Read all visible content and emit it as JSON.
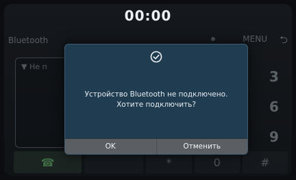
{
  "status": {
    "clock": "00:00"
  },
  "background_ui": {
    "title": "Bluetooth",
    "menu_label": "MENU",
    "back_icon": "back-arrow-icon",
    "input_text": "Не п",
    "keypad_digits": [
      "3",
      "6",
      "9"
    ],
    "bottom_keys": [
      "*",
      "0",
      "#"
    ]
  },
  "dialog": {
    "icon": "check-circle-icon",
    "message_line1": "Устройство Bluetooth не подключено.",
    "message_line2": "Хотите подключить?",
    "ok_label": "OK",
    "cancel_label": "Отменить"
  },
  "colors": {
    "dialog_bg": "#203c50",
    "button_bar": "#5b5e62"
  }
}
